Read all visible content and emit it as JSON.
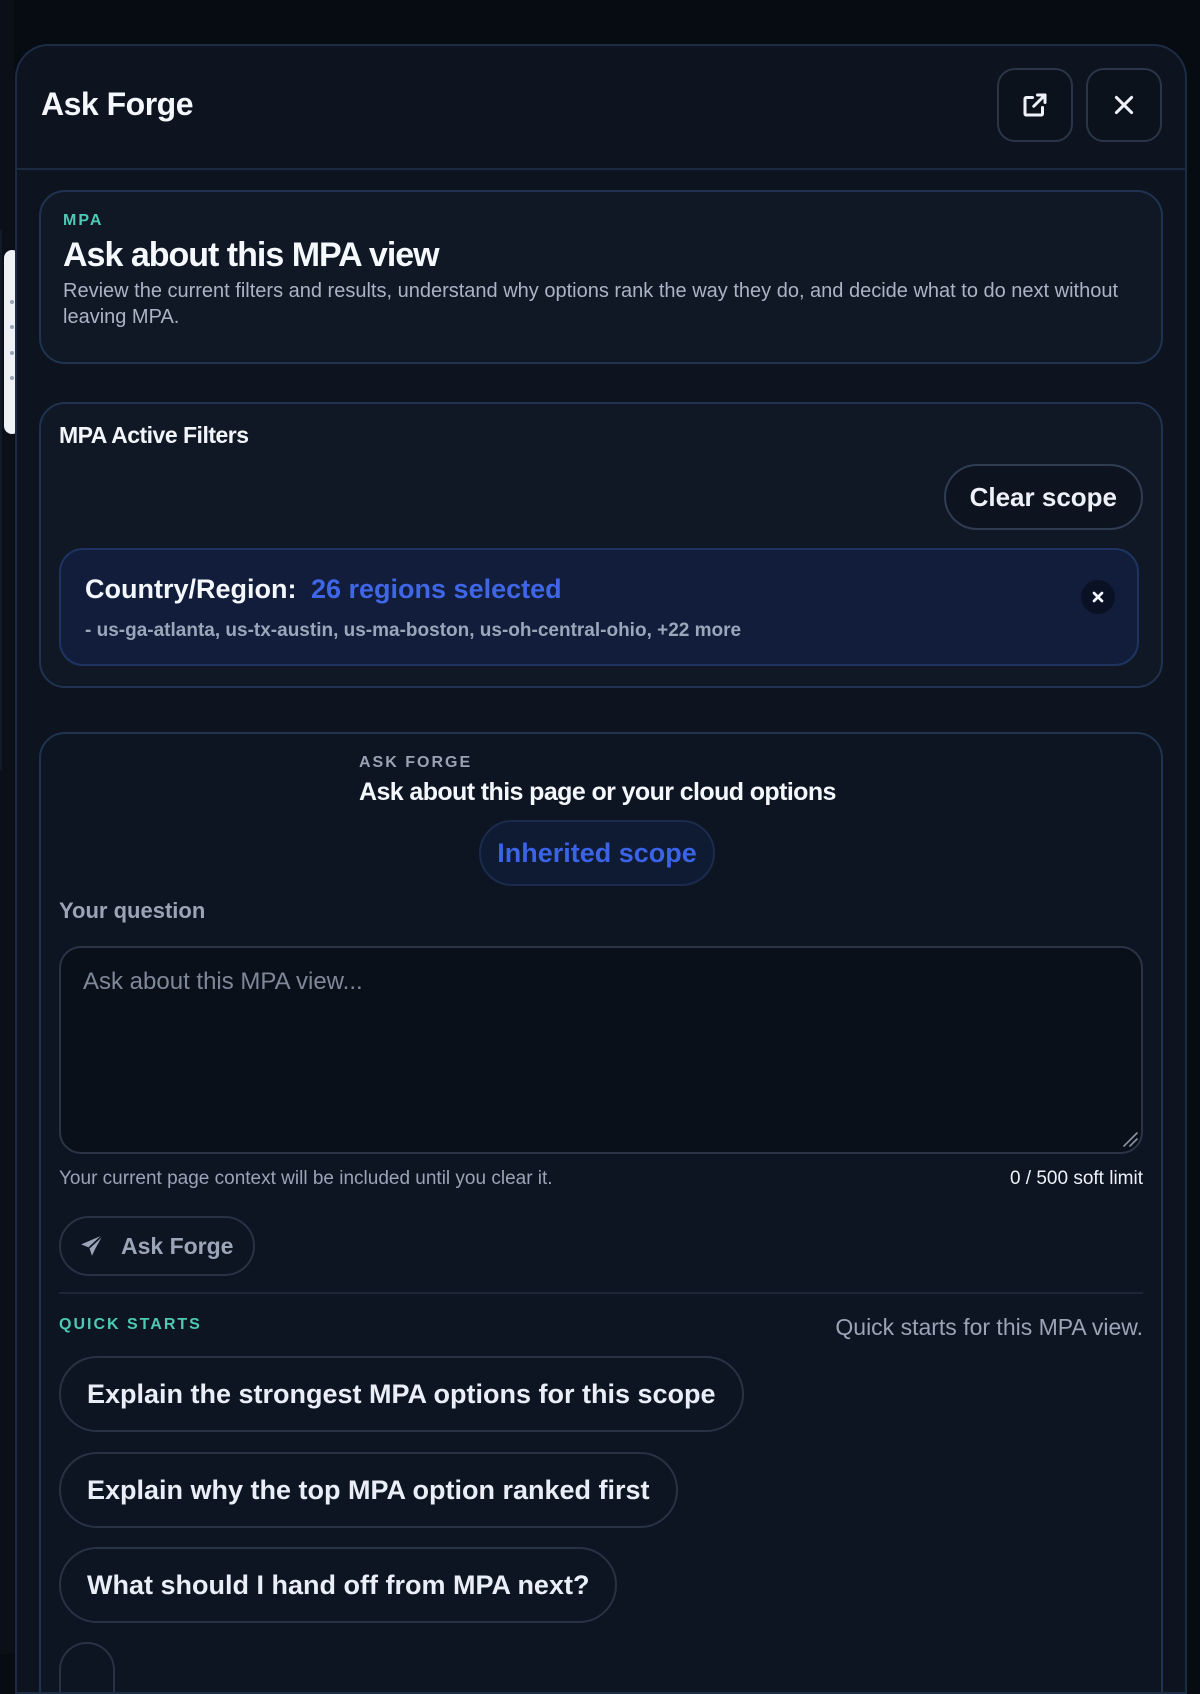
{
  "panel": {
    "title": "Ask Forge",
    "open_external_icon": "external-link-icon",
    "close_icon": "close-icon"
  },
  "intro": {
    "eyebrow": "MPA",
    "title": "Ask about this MPA view",
    "description": "Review the current filters and results, understand why options rank the way they do, and decide what to do next without leaving MPA."
  },
  "filters": {
    "title": "MPA Active Filters",
    "clear_label": "Clear scope",
    "chip": {
      "label": "Country/Region:",
      "value": "26 regions selected",
      "detail": "- us-ga-atlanta, us-tx-austin, us-ma-boston, us-oh-central-ohio, +22 more",
      "remove_icon": "close-icon"
    }
  },
  "ask": {
    "eyebrow": "ASK FORGE",
    "title": "Ask about this page or your cloud options",
    "scope_badge": "Inherited scope",
    "question_label": "Your question",
    "question_placeholder": "Ask about this MPA view...",
    "question_value": "",
    "hint": "Your current page context will be included until you clear it.",
    "limit": "0 / 500 soft limit",
    "submit_label": "Ask Forge",
    "submit_icon": "send-icon"
  },
  "quick_starts": {
    "eyebrow": "QUICK STARTS",
    "note": "Quick starts for this MPA view.",
    "items": [
      "Explain the strongest MPA options for this scope",
      "Explain why the top MPA option ranked first",
      "What should I hand off from MPA next?",
      ""
    ]
  },
  "colors": {
    "accent_teal": "#4fc9b3",
    "accent_blue": "#3f66e6",
    "panel_bg": "#0d1420",
    "page_bg": "#070b12"
  }
}
